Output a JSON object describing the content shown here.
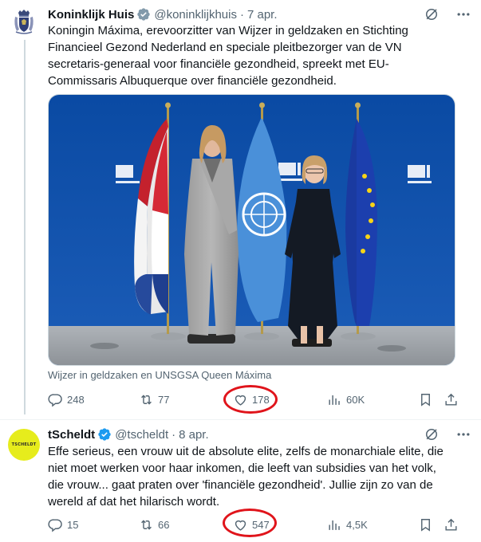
{
  "colors": {
    "accent": "#1d9bf0",
    "text": "#0f1419",
    "secondary": "#536471",
    "highlight_ring": "#e0141b"
  },
  "tweets": [
    {
      "name": "Koninklijk Huis",
      "handle": "@koninklijkhuis",
      "separator": "·",
      "date": "7 apr.",
      "badge": "verified-badge-gray",
      "lines": [
        "Koningin Máxima, erevoorzitter van Wijzer in geldzaken en Stichting",
        "Financieel Gezond Nederland en speciale pleitbezorger van de VN",
        "secretaris-generaal voor financiële gezondheid, spreekt met EU-",
        "Commissaris Albuquerque over financiële gezondheid."
      ],
      "media_caption": "Wijzer in geldzaken en UNSGSA Queen Máxima",
      "stats": {
        "replies": "248",
        "reposts": "77",
        "likes": "178",
        "views": "60K"
      }
    },
    {
      "name": "tScheldt",
      "handle": "@tscheldt",
      "separator": "·",
      "date": "8 apr.",
      "badge": "verified-badge-blue",
      "avatar_text": "TSCHELDT",
      "lines": [
        "Effe serieus, een vrouw uit de absolute elite, zelfs de monarchiale elite, die",
        "niet moet werken voor haar inkomen, die leeft van subsidies van het volk,",
        "die vrouw... gaat praten over 'financiële gezondheid'. Jullie zijn zo van de",
        "wereld af dat het hilarisch wordt."
      ],
      "stats": {
        "replies": "15",
        "reposts": "66",
        "likes": "547",
        "views": "4,5K"
      }
    }
  ]
}
